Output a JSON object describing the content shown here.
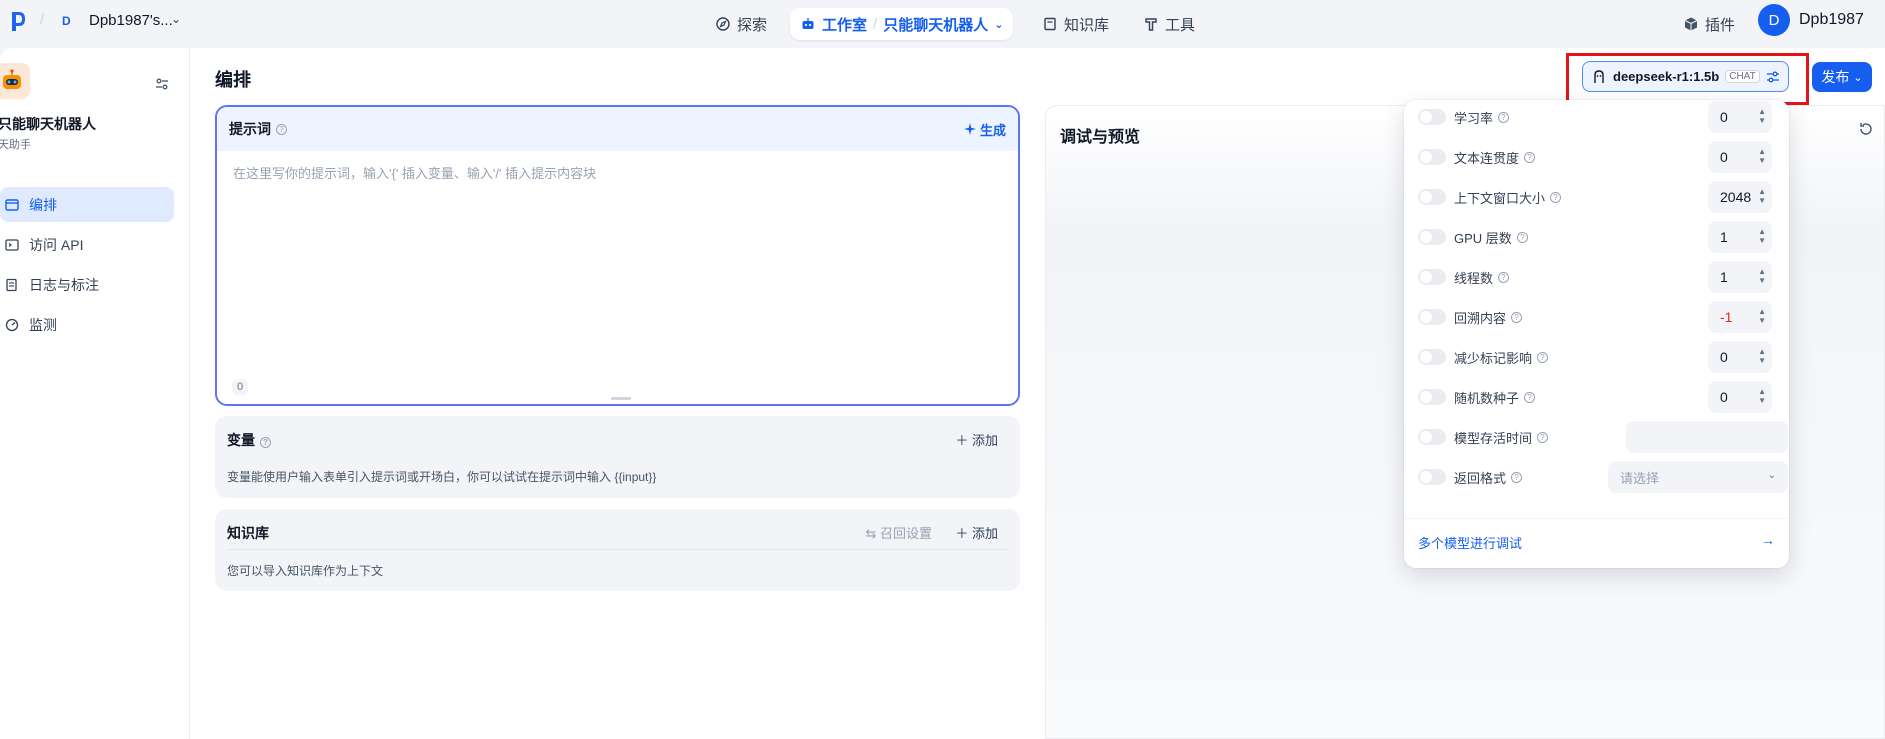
{
  "topbar": {
    "workspace_badge": "D",
    "workspace_name": "Dpb1987's...",
    "nav": {
      "explore": "探索",
      "studio": "工作室",
      "current_app": "只能聊天机器人",
      "knowledge": "知识库",
      "tools": "工具"
    },
    "plugins": "插件",
    "avatar_letter": "D",
    "user_name": "Dpb1987"
  },
  "sidebar": {
    "app_name": "只能聊天机器人",
    "app_type": "天助手",
    "items": [
      {
        "label": "编排",
        "icon": "layout-icon",
        "active": true
      },
      {
        "label": "访问 API",
        "icon": "terminal-icon",
        "active": false
      },
      {
        "label": "日志与标注",
        "icon": "log-icon",
        "active": false
      },
      {
        "label": "监测",
        "icon": "monitor-icon",
        "active": false
      }
    ]
  },
  "main": {
    "title": "编排",
    "prompt": {
      "label": "提示词",
      "generate": "生成",
      "placeholder": "在这里写你的提示词，输入'{' 插入变量、输入'/' 插入提示内容块",
      "char_count": "0"
    },
    "variables": {
      "title": "变量",
      "add": "添加",
      "desc": "变量能使用户输入表单引入提示词或开场白，你可以试试在提示词中输入 {{input}}"
    },
    "knowledge": {
      "title": "知识库",
      "recall": "召回设置",
      "add": "添加",
      "desc": "您可以导入知识库作为上下文"
    },
    "debug": {
      "title": "调试与预览"
    }
  },
  "model": {
    "name": "deepseek-r1:1.5b",
    "tag": "CHAT",
    "publish": "发布"
  },
  "params": [
    {
      "label": "学习率",
      "value": "0",
      "type": "number"
    },
    {
      "label": "文本连贯度",
      "value": "0",
      "type": "number"
    },
    {
      "label": "上下文窗口大小",
      "value": "2048",
      "type": "number"
    },
    {
      "label": "GPU 层数",
      "value": "1",
      "type": "number"
    },
    {
      "label": "线程数",
      "value": "1",
      "type": "number"
    },
    {
      "label": "回溯内容",
      "value": "-1",
      "type": "number"
    },
    {
      "label": "减少标记影响",
      "value": "0",
      "type": "number"
    },
    {
      "label": "随机数种子",
      "value": "0",
      "type": "number"
    },
    {
      "label": "模型存活时间",
      "value": "",
      "type": "text"
    },
    {
      "label": "返回格式",
      "value": "请选择",
      "type": "select"
    }
  ],
  "multi_model": "多个模型进行调试",
  "colors": {
    "accent": "#155eef",
    "highlight_border": "#e4141b",
    "prompt_border": "#6172f3"
  }
}
